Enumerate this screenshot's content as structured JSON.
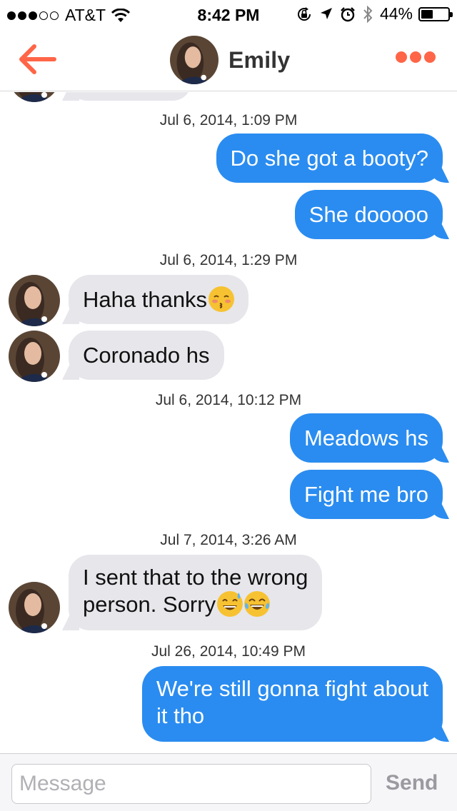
{
  "status_bar": {
    "carrier": "AT&T",
    "signal_bars_filled": 3,
    "signal_bars_total": 5,
    "time": "8:42 PM",
    "battery": "44%",
    "battery_level": 0.44,
    "icons": [
      "signal-dots",
      "wifi-icon",
      "rotation-lock-icon",
      "location-icon",
      "alarm-icon",
      "bluetooth-icon",
      "battery-icon"
    ]
  },
  "header": {
    "contact_name": "Emily",
    "back_icon": "back-arrow-icon",
    "more_icon": "more-dots-icon",
    "accent_color": "#ff6547"
  },
  "colors": {
    "outgoing_bubble": "#2a8cf0",
    "incoming_bubble": "#e6e6eb"
  },
  "conversation": {
    "groups": [
      {
        "timestamp": "Jul 6, 2014, 1:09 PM",
        "messages": [
          {
            "direction": "out",
            "text": "Do she got a booty?"
          },
          {
            "direction": "out",
            "text": "She dooooo"
          }
        ]
      },
      {
        "timestamp": "Jul 6, 2014, 1:29 PM",
        "messages": [
          {
            "direction": "in",
            "text": "Haha thanks",
            "emoji": [
              "blushing-kiss-emoji"
            ]
          },
          {
            "direction": "in",
            "text": "Coronado hs"
          }
        ]
      },
      {
        "timestamp": "Jul 6, 2014, 10:12 PM",
        "messages": [
          {
            "direction": "out",
            "text": "Meadows hs"
          },
          {
            "direction": "out",
            "text": "Fight me bro"
          }
        ]
      },
      {
        "timestamp": "Jul 7, 2014, 3:26 AM",
        "messages": [
          {
            "direction": "in",
            "line1": "I sent that to the wrong",
            "line2": "person. Sorry",
            "emoji": [
              "sweat-smile-emoji",
              "tears-of-joy-emoji"
            ]
          }
        ]
      },
      {
        "timestamp": "Jul 26, 2014, 10:49 PM",
        "messages": [
          {
            "direction": "out",
            "line1": "We're still gonna fight about",
            "line2": "it tho"
          }
        ]
      }
    ]
  },
  "composer": {
    "placeholder": "Message",
    "value": "",
    "send_label": "Send"
  }
}
